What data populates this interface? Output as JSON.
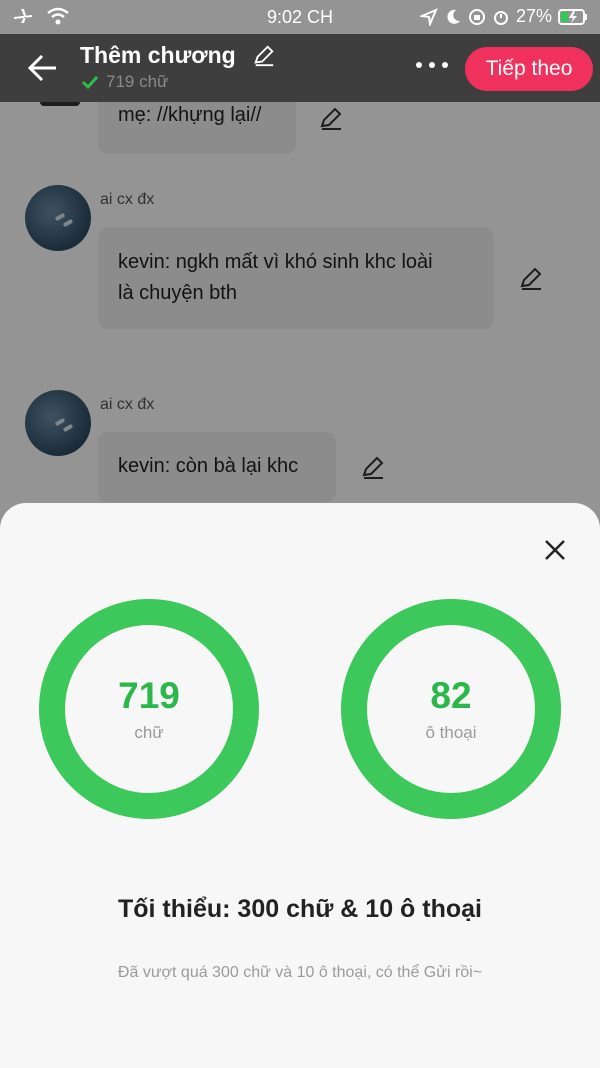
{
  "status_bar": {
    "time": "9:02 CH",
    "battery": "27%"
  },
  "header": {
    "title": "Thêm chương",
    "word_count": "719 chữ",
    "next_label": "Tiếp theo"
  },
  "messages": [
    {
      "sender": "",
      "text": "mẹ: //khựng lại//"
    },
    {
      "sender": "ai cx đx",
      "text_line1": "kevin: ngkh mất vì khó sinh khc loài",
      "text_line2": "là chuyện bth"
    },
    {
      "sender": "ai cx đx",
      "text": "kevin: còn bà lại khc"
    }
  ],
  "sheet": {
    "words": {
      "value": "719",
      "label": "chữ"
    },
    "dialogues": {
      "value": "82",
      "label": "ô thoại"
    },
    "minimum": "Tối thiểu: 300 chữ & 10 ô thoại",
    "note": "Đã vượt quá 300 chữ và 10 ô thoại, có thể Gửi rồi~"
  },
  "colors": {
    "accent": "#f0315d",
    "ring": "#3cc85a",
    "number": "#2bb749"
  }
}
